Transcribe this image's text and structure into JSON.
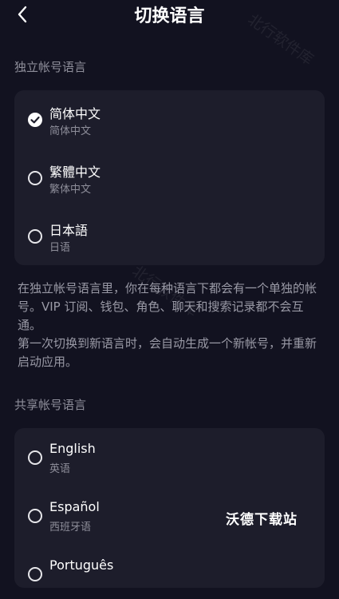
{
  "header": {
    "title": "切换语言"
  },
  "independent": {
    "label": "独立帐号语言",
    "options": [
      {
        "title": "简体中文",
        "subtitle": "简体中文",
        "selected": true
      },
      {
        "title": "繁體中文",
        "subtitle": "繁体中文",
        "selected": false
      },
      {
        "title": "日本語",
        "subtitle": "日语",
        "selected": false
      }
    ]
  },
  "description": {
    "p1": "在独立帐号语言里，你在每种语言下都会有一个单独的帐号。VIP 订阅、钱包、角色、聊天和搜索记录都不会互通。",
    "p2": "第一次切换到新语言时，会自动生成一个新帐号，并重新启动应用。"
  },
  "shared": {
    "label": "共享帐号语言",
    "options": [
      {
        "title": "English",
        "subtitle": "英语",
        "selected": false
      },
      {
        "title": "Español",
        "subtitle": "西班牙语",
        "selected": false
      },
      {
        "title": "Português",
        "subtitle": "",
        "selected": false
      }
    ]
  },
  "watermark": {
    "text": "沃德下载站",
    "bg_text": "北行软件库"
  },
  "colors": {
    "background": "#121220",
    "card": "#1d1d2b",
    "secondary_text": "#8e8e9a"
  }
}
